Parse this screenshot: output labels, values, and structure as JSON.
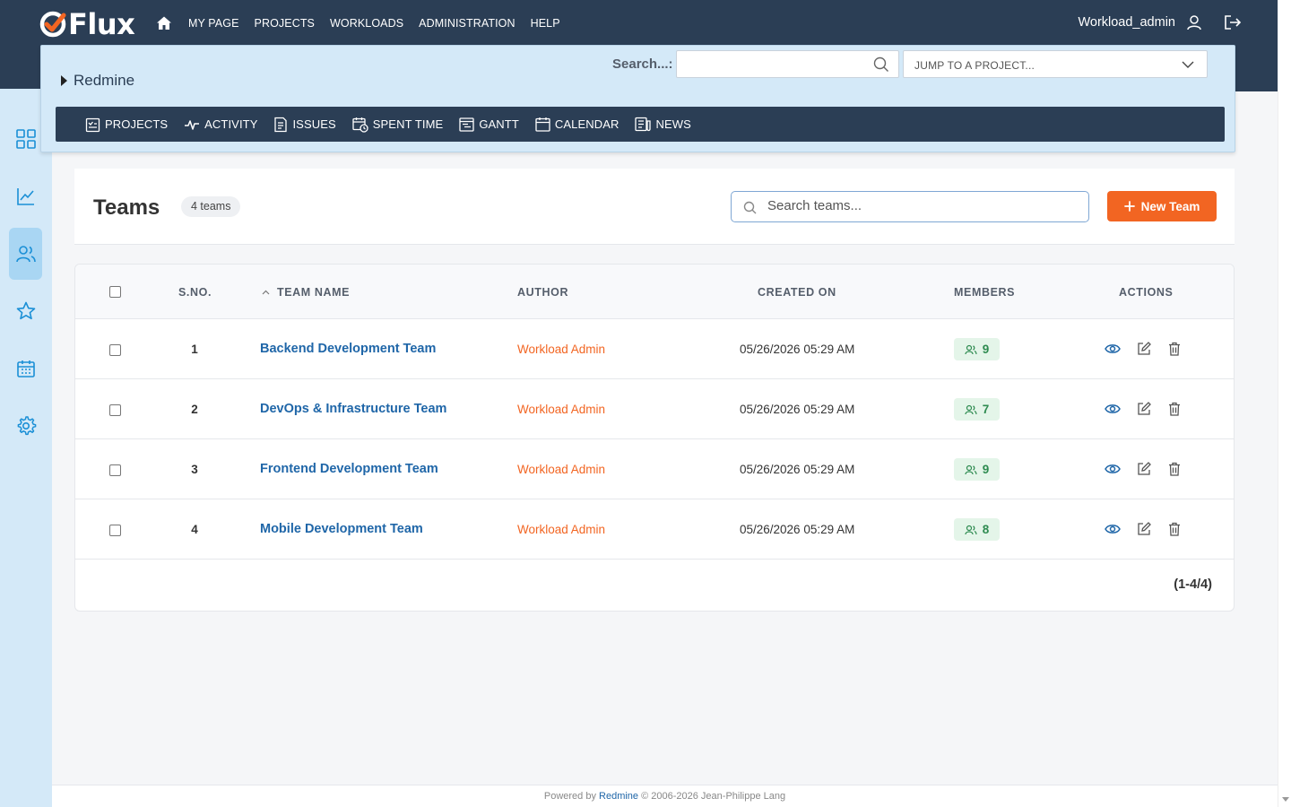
{
  "app": {
    "logo_text": "Flux"
  },
  "topnav": {
    "items": [
      "MY PAGE",
      "PROJECTS",
      "WORKLOADS",
      "ADMINISTRATION",
      "HELP"
    ],
    "user": "Workload_admin"
  },
  "project": {
    "name": "Redmine",
    "search_label": "Search...:",
    "search_value": "",
    "jump_placeholder": "JUMP TO A PROJECT...",
    "menu": [
      "PROJECTS",
      "ACTIVITY",
      "ISSUES",
      "SPENT TIME",
      "GANTT",
      "CALENDAR",
      "NEWS"
    ]
  },
  "sidebar": {
    "items": [
      "grid-icon",
      "chart-icon",
      "users-icon",
      "star-icon",
      "calendar-icon",
      "gear-icon"
    ],
    "active": "users-icon"
  },
  "teams": {
    "title": "Teams",
    "count_label": "4 teams",
    "search_placeholder": "Search teams...",
    "new_button": "New Team",
    "columns": [
      "S.NO.",
      "TEAM NAME",
      "AUTHOR",
      "CREATED ON",
      "MEMBERS",
      "ACTIONS"
    ],
    "rows": [
      {
        "sno": "1",
        "name": "Backend Development Team",
        "author": "Workload Admin",
        "created": "05/26/2026 05:29 AM",
        "members": "9"
      },
      {
        "sno": "2",
        "name": "DevOps & Infrastructure Team",
        "author": "Workload Admin",
        "created": "05/26/2026 05:29 AM",
        "members": "7"
      },
      {
        "sno": "3",
        "name": "Frontend Development Team",
        "author": "Workload Admin",
        "created": "05/26/2026 05:29 AM",
        "members": "9"
      },
      {
        "sno": "4",
        "name": "Mobile Development Team",
        "author": "Workload Admin",
        "created": "05/26/2026 05:29 AM",
        "members": "8"
      }
    ],
    "pagination": "(1-4/4)"
  },
  "footer": {
    "prefix": "Powered by",
    "link": "Redmine",
    "suffix": "© 2006-2026 Jean-Philippe Lang"
  },
  "colors": {
    "topbar": "#2b3e55",
    "panel": "#d4e9f8",
    "accent": "#f26522",
    "link": "#1f66a8",
    "members_badge": "#e4f5e9"
  }
}
